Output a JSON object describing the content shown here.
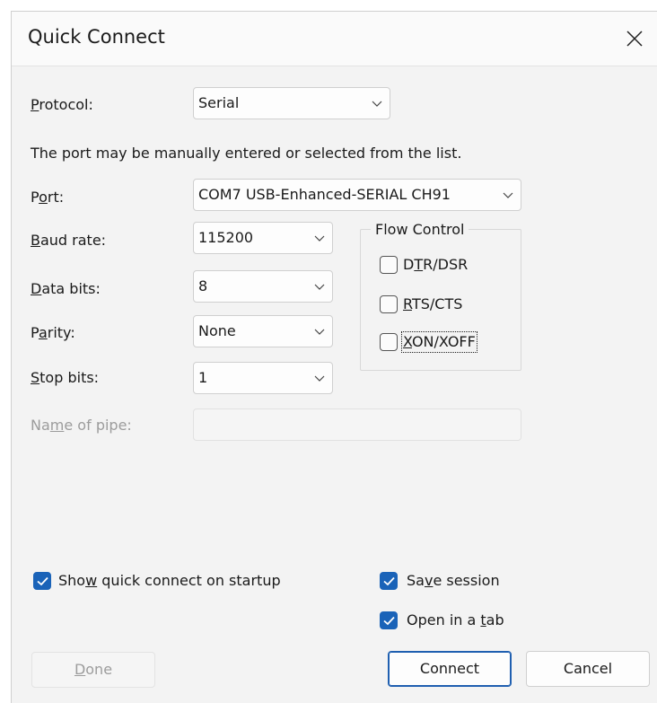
{
  "dialog": {
    "title": "Quick Connect"
  },
  "protocol": {
    "label_pre": "",
    "label_mnemonic": "P",
    "label_post": "rotocol:",
    "value": "Serial"
  },
  "instruction": "The port may be manually entered or selected from the list.",
  "port": {
    "label_pre": "P",
    "label_mnemonic": "o",
    "label_post": "rt:",
    "value": "COM7 USB-Enhanced-SERIAL CH91"
  },
  "baud_rate": {
    "label_pre": "",
    "label_mnemonic": "B",
    "label_post": "aud rate:",
    "value": "115200"
  },
  "data_bits": {
    "label_pre": "",
    "label_mnemonic": "D",
    "label_post": "ata bits:",
    "value": "8"
  },
  "parity": {
    "label_pre": "P",
    "label_mnemonic": "a",
    "label_post": "rity:",
    "value": "None"
  },
  "stop_bits": {
    "label_pre": "",
    "label_mnemonic": "S",
    "label_post": "top bits:",
    "value": "1"
  },
  "name_of_pipe": {
    "label_pre": "Na",
    "label_mnemonic": "m",
    "label_post": "e of pipe:",
    "value": ""
  },
  "flow_control": {
    "title": "Flow Control",
    "dtr_dsr": {
      "pre": "D",
      "mnemonic": "T",
      "post": "R/DSR",
      "checked": false
    },
    "rts_cts": {
      "pre": "",
      "mnemonic": "R",
      "post": "TS/CTS",
      "checked": false
    },
    "xon_xoff": {
      "pre": "",
      "mnemonic": "X",
      "post": "ON/XOFF",
      "checked": false
    }
  },
  "options": {
    "show_on_startup": {
      "pre": "Sho",
      "mnemonic": "w",
      "post": " quick connect on startup",
      "checked": true
    },
    "save_session": {
      "pre": "Sa",
      "mnemonic": "v",
      "post": "e session",
      "checked": true
    },
    "open_in_tab": {
      "pre": "Open in a ",
      "mnemonic": "t",
      "post": "ab",
      "checked": true
    }
  },
  "buttons": {
    "done_pre": "",
    "done_mnemonic": "D",
    "done_post": "one",
    "connect": "Connect",
    "cancel": "Cancel"
  },
  "colors": {
    "accent": "#1a63b8",
    "dialog_bg": "#f3f3f3",
    "disabled_text": "#9c9c9c"
  },
  "icons": {
    "close": "close-icon",
    "dropdown": "chevron-down-icon",
    "check": "check-icon"
  }
}
